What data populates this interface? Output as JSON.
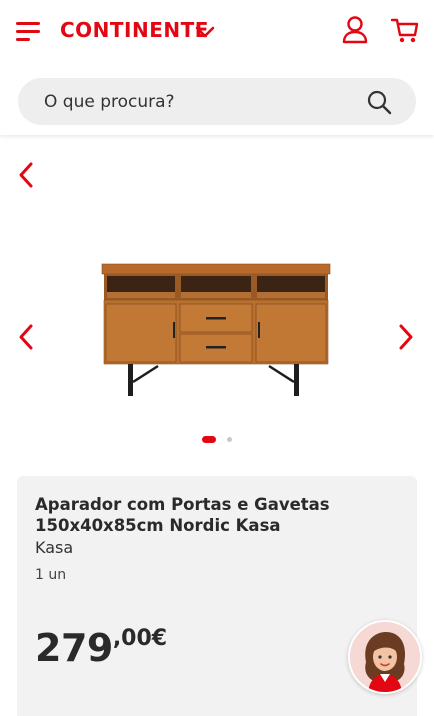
{
  "header": {
    "logo_text": "CONTINENTE",
    "brand_color": "#e30613",
    "icons": [
      "menu-icon",
      "chevron-down-icon",
      "user-icon",
      "cart-icon"
    ]
  },
  "search": {
    "placeholder": "O que procura?",
    "icon": "search-icon"
  },
  "gallery": {
    "icons": [
      "chevron-left-icon",
      "chevron-left-icon",
      "chevron-right-icon"
    ],
    "image": "sideboard-product-image",
    "slide_count": 2,
    "active_slide": 1
  },
  "product": {
    "title": "Aparador com Portas e Gavetas 150x40x85cm Nordic Kasa",
    "brand": "Kasa",
    "quantity": "1 un",
    "price_int": "279",
    "price_dec": ",00€"
  },
  "assistant": {
    "icon": "assistant-avatar"
  }
}
